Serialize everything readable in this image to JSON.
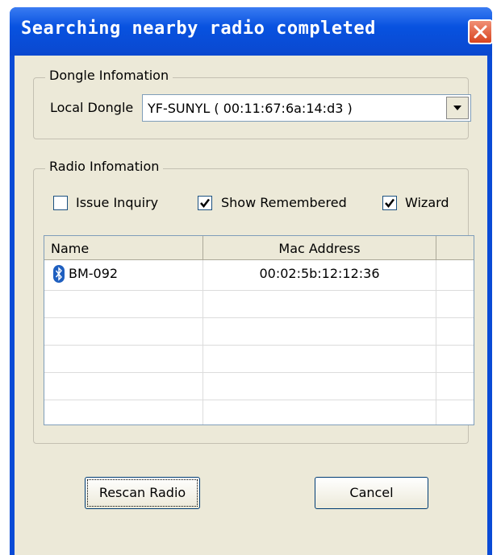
{
  "window": {
    "title": "Searching nearby radio completed"
  },
  "dongle": {
    "group_label": "Dongle Infomation",
    "local_label": "Local Dongle",
    "selected": "YF-SUNYL ( 00:11:67:6a:14:d3 )"
  },
  "radio": {
    "group_label": "Radio Infomation",
    "options": [
      {
        "label": "Issue Inquiry",
        "checked": false
      },
      {
        "label": "Show Remembered",
        "checked": true
      },
      {
        "label": "Wizard",
        "checked": true
      }
    ],
    "columns": [
      "Name",
      "Mac Address"
    ],
    "rows": [
      {
        "icon": "bluetooth-icon",
        "name": "BM-092",
        "mac": "00:02:5b:12:12:36"
      }
    ]
  },
  "buttons": {
    "rescan": "Rescan Radio",
    "cancel": "Cancel"
  },
  "icons": {
    "close": "close-icon",
    "dropdown": "chevron-down-icon",
    "checkbox": "checkmark-icon",
    "device": "bluetooth-icon"
  },
  "colors": {
    "titlebar": "#0852e0",
    "close_button": "#d8441f",
    "dialog_face": "#ece9d8",
    "bluetooth": "#1f5fbf"
  }
}
